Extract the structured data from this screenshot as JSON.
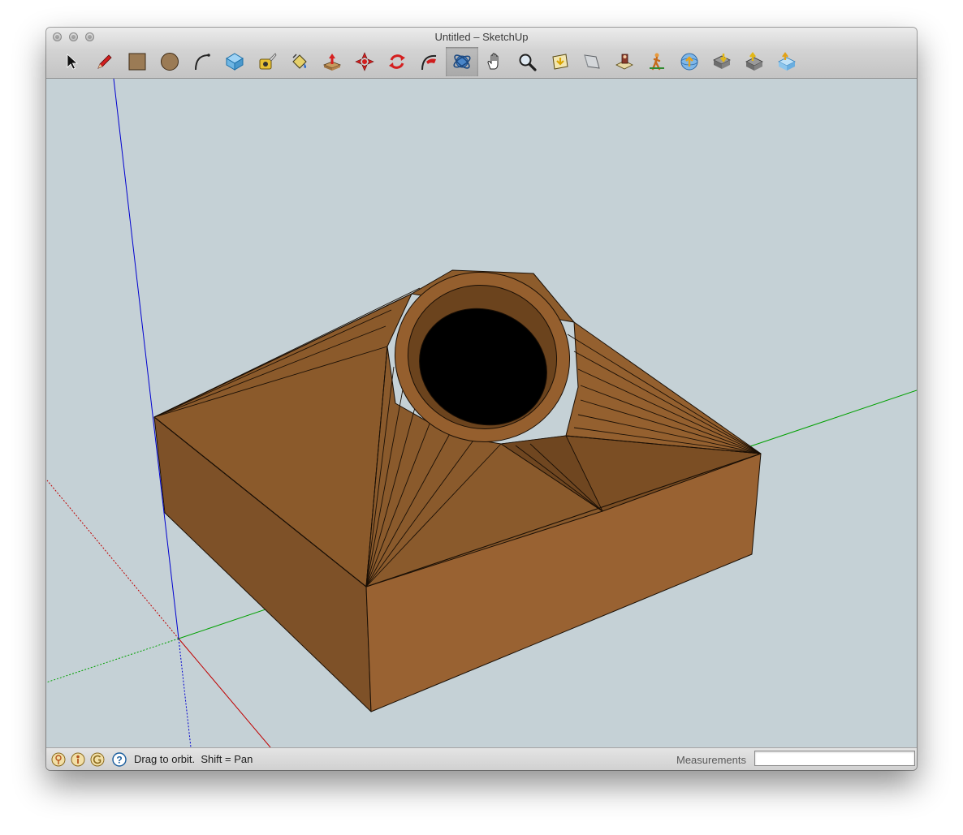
{
  "window": {
    "title": "Untitled – SketchUp"
  },
  "toolbar": {
    "tools": [
      {
        "id": "select",
        "icon": "select-arrow-icon"
      },
      {
        "id": "pencil",
        "icon": "pencil-icon"
      },
      {
        "id": "rectangle",
        "icon": "rectangle-icon"
      },
      {
        "id": "circle",
        "icon": "circle-icon"
      },
      {
        "id": "arc",
        "icon": "arc-icon"
      },
      {
        "id": "make-component",
        "icon": "make-component-icon"
      },
      {
        "id": "tape-measure",
        "icon": "tape-measure-icon"
      },
      {
        "id": "paint-bucket",
        "icon": "paint-bucket-icon"
      },
      {
        "id": "push-pull",
        "icon": "push-pull-icon"
      },
      {
        "id": "move",
        "icon": "move-icon"
      },
      {
        "id": "rotate",
        "icon": "rotate-icon"
      },
      {
        "id": "follow-me",
        "icon": "follow-me-icon"
      },
      {
        "id": "orbit",
        "icon": "orbit-icon",
        "active": true
      },
      {
        "id": "pan",
        "icon": "pan-hand-icon"
      },
      {
        "id": "zoom",
        "icon": "zoom-magnifier-icon"
      },
      {
        "id": "zoom-extents",
        "icon": "zoom-extents-icon"
      },
      {
        "id": "previous-view",
        "icon": "previous-view-icon"
      },
      {
        "id": "position-camera",
        "icon": "position-camera-icon"
      },
      {
        "id": "walk",
        "icon": "walk-icon"
      },
      {
        "id": "share-model",
        "icon": "share-model-icon"
      },
      {
        "id": "get-models",
        "icon": "get-models-icon"
      },
      {
        "id": "share-component",
        "icon": "share-component-icon"
      },
      {
        "id": "extension-warehouse",
        "icon": "extension-warehouse-icon"
      }
    ]
  },
  "viewport": {
    "background": "#c5d1d6",
    "axis_colors": {
      "red": "#c00000",
      "green": "#00a000",
      "blue": "#0000d0"
    },
    "model_colors": {
      "top": "#8b5a2b",
      "left": "#7e5128",
      "right": "#996232",
      "hole": "#000000"
    }
  },
  "statusbar": {
    "icons": [
      "geo-location-icon",
      "credits-icon",
      "sign-in-icon",
      "help-icon"
    ],
    "hint": "Drag to orbit.  Shift = Pan",
    "measurements_label": "Measurements",
    "measurements_value": ""
  }
}
